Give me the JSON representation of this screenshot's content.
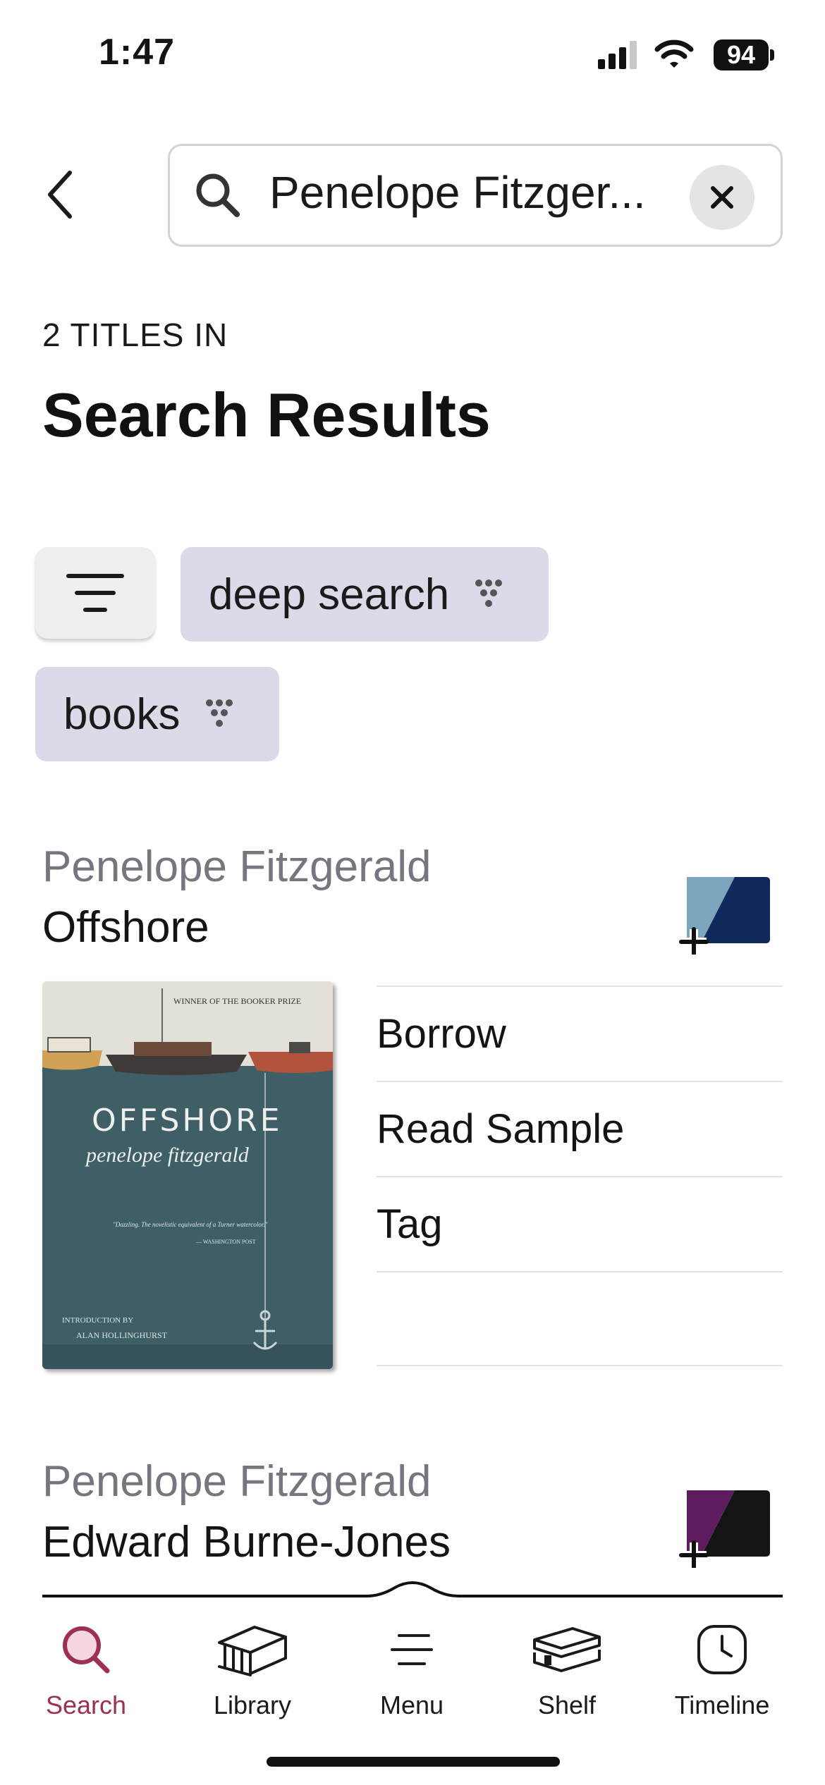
{
  "status_bar": {
    "time": "1:47",
    "battery": "94"
  },
  "search": {
    "query": "Penelope Fitzger..."
  },
  "results_header": {
    "count_label": "2 TITLES IN",
    "title": "Search Results"
  },
  "chips": [
    {
      "label": "deep search",
      "icon": "filter-dots-icon"
    },
    {
      "label": "books",
      "icon": "filter-dots-icon"
    }
  ],
  "results": [
    {
      "author": "Penelope Fitzgerald",
      "title": "Offshore",
      "shelf_colors": [
        "#7ca6bd",
        "#0f2a5a"
      ],
      "cover": {
        "top_text": "WINNER OF THE BOOKER PRIZE",
        "title": "OFFSHORE",
        "author": "penelope fitzgerald",
        "quote": "\"Dazzling. The novelistic equivalent of a Turner watercolor.\"",
        "quote_source": "— WASHINGTON POST",
        "intro_label": "INTRODUCTION BY",
        "intro_name": "ALAN HOLLINGHURST"
      },
      "actions": [
        "Borrow",
        "Read Sample",
        "Tag",
        ""
      ]
    },
    {
      "author": "Penelope Fitzgerald",
      "title": "Edward Burne-Jones",
      "shelf_colors": [
        "#5e1c5f",
        "#141414"
      ]
    }
  ],
  "tab_bar": {
    "active_color": "#9b2f56",
    "tabs": [
      {
        "label": "Search",
        "icon": "search-icon",
        "active": true
      },
      {
        "label": "Library",
        "icon": "library-icon",
        "active": false
      },
      {
        "label": "Menu",
        "icon": "menu-icon",
        "active": false
      },
      {
        "label": "Shelf",
        "icon": "books-stack-icon",
        "active": false
      },
      {
        "label": "Timeline",
        "icon": "clock-icon",
        "active": false
      }
    ]
  }
}
